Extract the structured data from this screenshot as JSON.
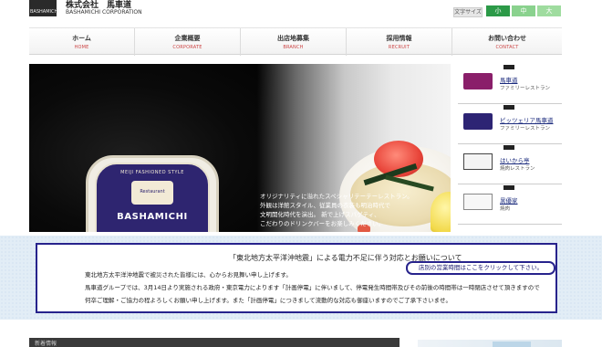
{
  "header": {
    "logo_text": "BASHAMICHI",
    "company_jp": "株式会社　馬車道",
    "company_en": "BASHAMICHI CORPORATION",
    "font_size": {
      "label": "文字サイズ",
      "small": "小",
      "medium": "中",
      "large": "大"
    }
  },
  "nav": [
    {
      "jp": "ホーム",
      "en": "HOME"
    },
    {
      "jp": "企業概要",
      "en": "CORPORATE"
    },
    {
      "jp": "出店地募集",
      "en": "BRANCH"
    },
    {
      "jp": "採用情報",
      "en": "RECRUIT"
    },
    {
      "jp": "お問い合わせ",
      "en": "CONTACT"
    }
  ],
  "main_visual": {
    "sign_arc": "MEIJI FASHIONED STYLE",
    "sign_crest": "Restaurant",
    "sign_brand": "BASHAMICHI",
    "copy_lines": [
      "オリジナリティに溢れたスペシャリテーテーレストラン。",
      "外観は洋館スタイル、従業員の衣装も明治時代で",
      "文明開化時代を演出。 新で上げスパゲティ、",
      "こだわりのドリンクバーをお楽しみください。"
    ]
  },
  "brands": [
    {
      "name": "馬車道",
      "type": "ファミリーレストラン",
      "logo": "bashamichi-logo-icon"
    },
    {
      "name": "ピッツェリア馬車道",
      "type": "ファミリーレストラン",
      "logo": "pizzeria-bashamichi-logo-icon"
    },
    {
      "name": "はいから亭",
      "type": "焼肉レストラン",
      "logo": "haikaratei-logo-icon"
    },
    {
      "name": "黒優家",
      "type": "焼肉",
      "logo": "kuroyuka-logo-icon"
    }
  ],
  "notice": {
    "title": "「東北地方太平洋沖地震」による電力不足に伴う対応とお願いについて",
    "hours_link": "店別の営業時間はここをクリックして下さい。",
    "lines": [
      "東北地方太平洋沖地震で被災された皆様には、心からお見舞い申し上げます。",
      "馬車道グループでは、3月14日より実施される政府・東京電力によります「計画停電」に伴いまして、停電発生時間帯及びその前後の時間帯は一時閉店させて頂きますので",
      "何卒ご理解・ご協力の程よろしくお願い申し上げます。また「計画停電」につきまして流動的な対応も御座いますのでご了承下さいませ。"
    ]
  },
  "news": {
    "heading": "新着情報"
  },
  "colors": {
    "accent_green": "#2c9a48",
    "notice_border": "#27238c",
    "nav_en": "#c44444",
    "brand_link": "#1a2a7c"
  }
}
